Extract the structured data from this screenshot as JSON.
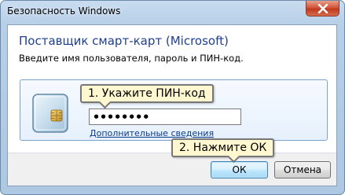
{
  "window": {
    "title": "Безопасность Windows",
    "close_icon": "close-icon"
  },
  "header": {
    "provider_title": "Поставщик смарт-карт (Microsoft)",
    "instruction": "Введите имя пользователя, пароль и ПИН-код."
  },
  "credential": {
    "icon": "smart-card-icon",
    "pin_value": "••••••••",
    "details_link": "Дополнительные сведения"
  },
  "callouts": {
    "step1": "1. Укажите ПИН-код",
    "step2": "2. Нажмите ОК"
  },
  "buttons": {
    "ok": "ОК",
    "cancel": "Отмена"
  },
  "colors": {
    "title_blue": "#1e3f8f",
    "link_blue": "#0b3c8c",
    "callout_bg": "#fff7cf",
    "close_red": "#c0391f"
  }
}
